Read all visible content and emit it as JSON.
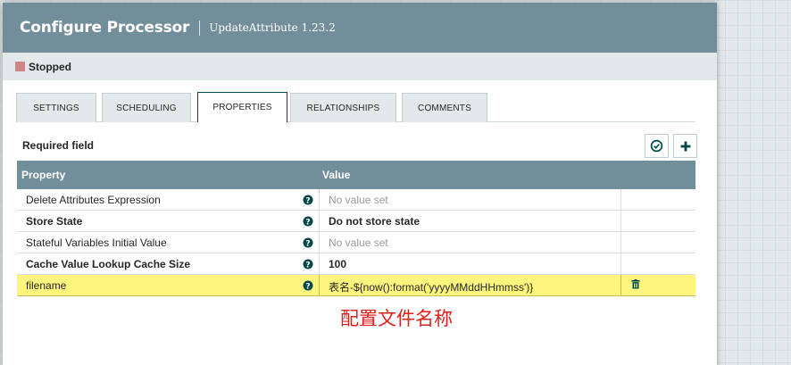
{
  "dialog": {
    "title": "Configure Processor",
    "subtitle": "UpdateAttribute 1.23.2"
  },
  "status": {
    "label": "Stopped",
    "color": "#d18686"
  },
  "tabs": [
    {
      "label": "SETTINGS",
      "active": false
    },
    {
      "label": "SCHEDULING",
      "active": false
    },
    {
      "label": "PROPERTIES",
      "active": true
    },
    {
      "label": "RELATIONSHIPS",
      "active": false
    },
    {
      "label": "COMMENTS",
      "active": false
    }
  ],
  "properties": {
    "required_label": "Required field",
    "verify_icon": "check-circle-icon",
    "add_icon": "plus-icon",
    "columns": {
      "property": "Property",
      "value": "Value"
    },
    "rows": [
      {
        "name": "Delete Attributes Expression",
        "value": "No value set",
        "required": false,
        "empty": true
      },
      {
        "name": "Store State",
        "value": "Do not store state",
        "required": true,
        "empty": false
      },
      {
        "name": "Stateful Variables Initial Value",
        "value": "No value set",
        "required": false,
        "empty": true
      },
      {
        "name": "Cache Value Lookup Cache Size",
        "value": "100",
        "required": true,
        "empty": false
      },
      {
        "name": "filename",
        "value": "表名-${now():format('yyyyMMddHHmmss')}",
        "required": false,
        "empty": false,
        "highlighted": true
      }
    ]
  },
  "annotation": {
    "text": "配置文件名称",
    "color": "#e0201c"
  },
  "colors": {
    "header": "#728e9b",
    "accent": "#004849",
    "highlight": "#fdf57d"
  }
}
